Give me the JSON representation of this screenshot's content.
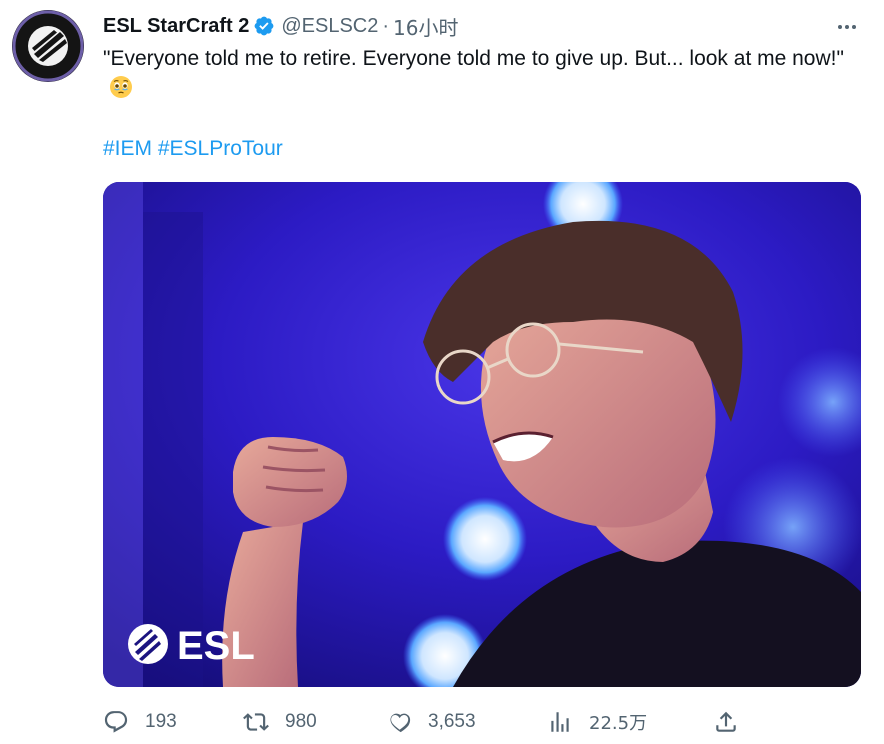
{
  "tweet": {
    "display_name": "ESL StarCraft 2",
    "handle": "@ESLSC2",
    "separator": "·",
    "time": "16小时",
    "text": "\"Everyone told me to retire. Everyone told me to give up. But... look at me now!\"",
    "hashtags": [
      "#IEM",
      "#ESLProTour"
    ],
    "media_watermark": "ESL"
  },
  "stats": {
    "replies": "193",
    "retweets": "980",
    "likes": "3,653",
    "views": "22.5万"
  },
  "colors": {
    "link": "#1d9bf0",
    "verified": "#1d9bf0",
    "muted": "#536471",
    "media_bg": "#2f1ec8"
  },
  "icons": {
    "more": "more-horizontal-icon",
    "verified": "verified-badge-icon",
    "reply": "reply-icon",
    "retweet": "retweet-icon",
    "like": "heart-icon",
    "views": "views-chart-icon",
    "share": "share-icon",
    "emoji": "face-holding-back-tears-emoji"
  }
}
